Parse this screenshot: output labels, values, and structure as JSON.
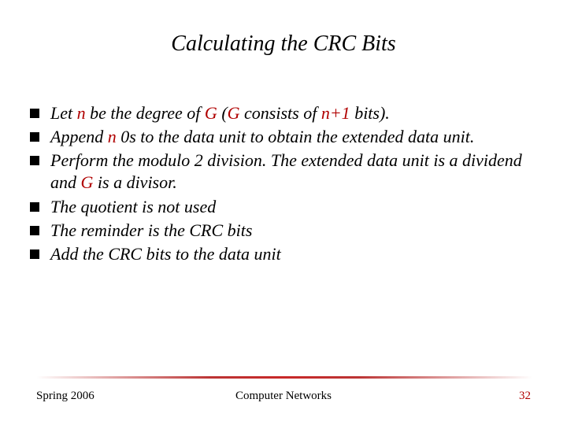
{
  "title": "Calculating the CRC Bits",
  "bullets": [
    {
      "parts": [
        {
          "t": "Let "
        },
        {
          "t": "n",
          "red": true
        },
        {
          "t": " be the degree of "
        },
        {
          "t": "G",
          "red": true
        },
        {
          "t": " ("
        },
        {
          "t": "G",
          "red": true
        },
        {
          "t": " consists of "
        },
        {
          "t": "n+1",
          "red": true
        },
        {
          "t": " bits)."
        }
      ]
    },
    {
      "parts": [
        {
          "t": "Append "
        },
        {
          "t": "n",
          "red": true
        },
        {
          "t": " 0s to the data unit to obtain the extended data unit."
        }
      ]
    },
    {
      "parts": [
        {
          "t": "Perform the modulo 2 division. The extended data unit is a dividend and "
        },
        {
          "t": "G",
          "red": true
        },
        {
          "t": " is a divisor."
        }
      ]
    },
    {
      "parts": [
        {
          "t": "The quotient is not used"
        }
      ]
    },
    {
      "parts": [
        {
          "t": "The reminder is the CRC bits"
        }
      ]
    },
    {
      "parts": [
        {
          "t": "Add the CRC bits to the data unit"
        }
      ]
    }
  ],
  "footer": {
    "left": "Spring 2006",
    "center": "Computer Networks",
    "right": "32"
  }
}
